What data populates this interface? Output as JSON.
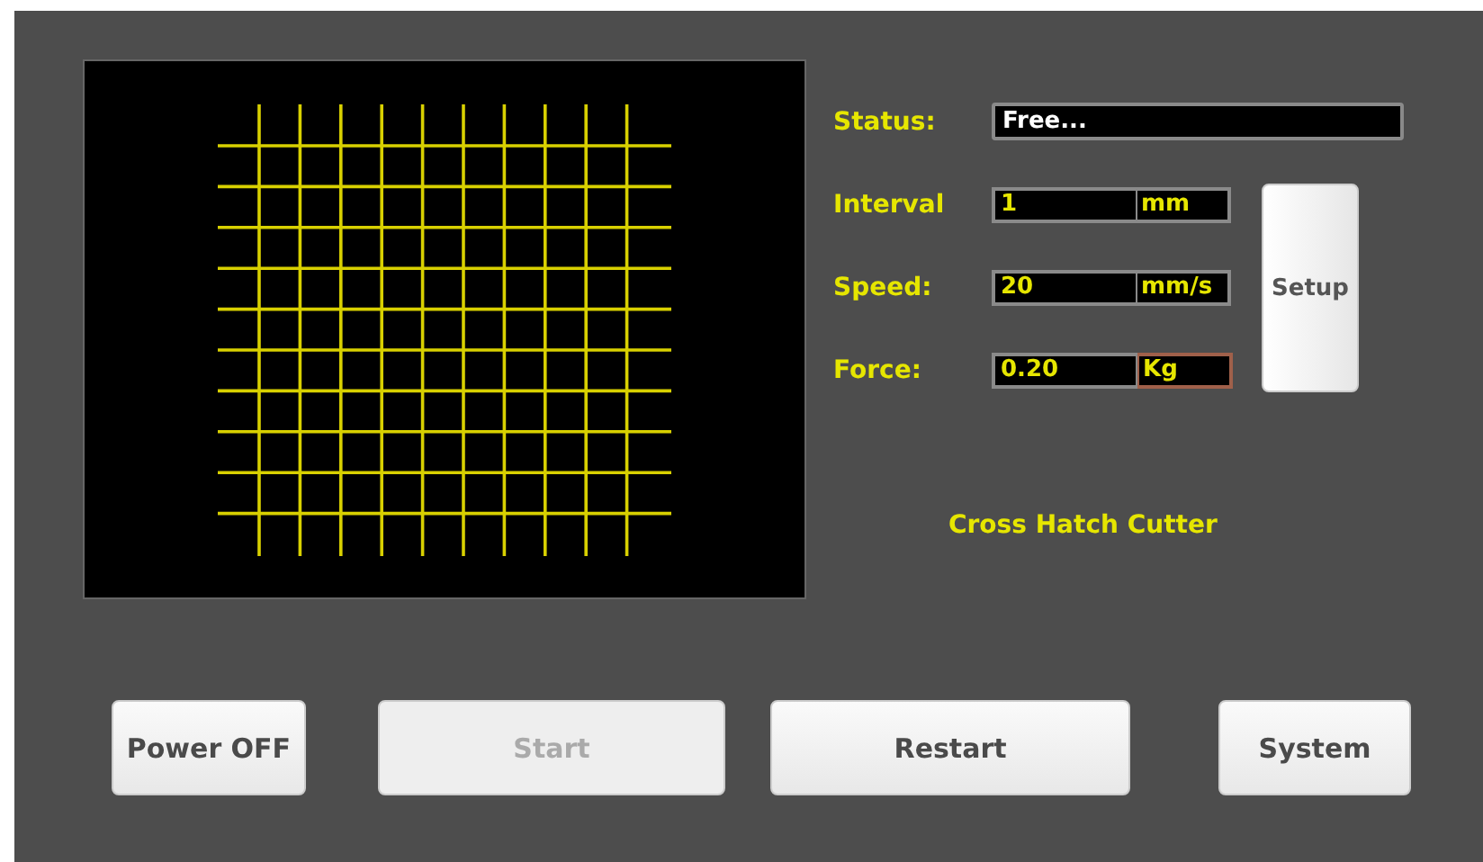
{
  "status": {
    "label": "Status:",
    "value": "Free..."
  },
  "fields": [
    {
      "label": "Interval",
      "value": "1",
      "unit": "mm",
      "focused": false
    },
    {
      "label": "Speed:",
      "value": "20",
      "unit": "mm/s",
      "focused": false
    },
    {
      "label": "Force:",
      "value": "0.20",
      "unit": "Kg",
      "focused": true
    }
  ],
  "setup_button": "Setup",
  "title": "Cross Hatch Cutter",
  "buttons": [
    {
      "label": "Power OFF",
      "disabled": false
    },
    {
      "label": "Start",
      "disabled": true
    },
    {
      "label": "Restart",
      "disabled": false
    },
    {
      "label": "System",
      "disabled": false
    }
  ]
}
